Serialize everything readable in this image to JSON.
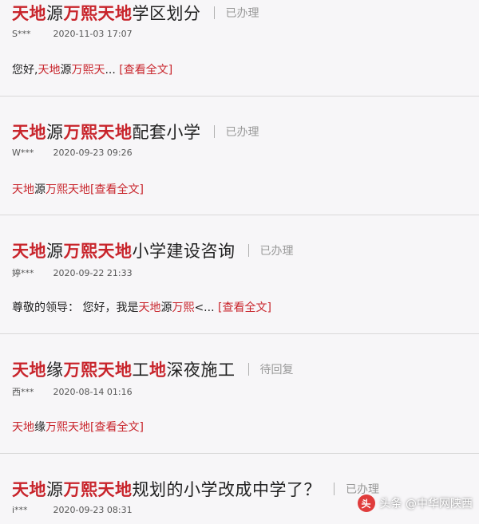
{
  "posts": [
    {
      "title_parts": [
        "天地",
        "源",
        "万熙天地",
        "学区划分"
      ],
      "status": "已办理",
      "user": "S***",
      "time": "2020-11-03 17:07",
      "snippet_parts": [
        "您好,",
        "天地",
        "源",
        "万熙天",
        "...",
        " [查看全文]"
      ]
    },
    {
      "title_parts": [
        "天地",
        "源",
        "万熙天地",
        "配套小学"
      ],
      "status": "已办理",
      "user": "W***",
      "time": "2020-09-23 09:26",
      "snippet_parts": [
        "",
        "天地",
        "源",
        "万熙天地",
        "",
        "[查看全文]"
      ]
    },
    {
      "title_parts": [
        "天地",
        "源",
        "万熙天地",
        "小学建设咨询"
      ],
      "status": "已办理",
      "user": "婷***",
      "time": "2020-09-22 21:33",
      "snippet_parts": [
        "尊敬的领导： 您好，我是",
        "天地",
        "源",
        "万熙",
        "<...",
        " [查看全文]"
      ]
    },
    {
      "title_parts": [
        "天地",
        "缘",
        "万熙天地",
        "工",
        "地",
        "深夜施工"
      ],
      "status": "待回复",
      "user": "西***",
      "time": "2020-08-14 01:16",
      "snippet_parts": [
        "",
        "天地",
        "缘",
        "万熙天地",
        "",
        "[查看全文]"
      ]
    },
    {
      "title_parts": [
        "天地",
        "源",
        "万熙天地",
        "规划的小学改成中学了？"
      ],
      "status": "已办理",
      "user": "i***",
      "time": "2020-09-23 08:31"
    }
  ],
  "watermark": {
    "icon_text": "头",
    "label": "头条 @中华网陕西"
  }
}
